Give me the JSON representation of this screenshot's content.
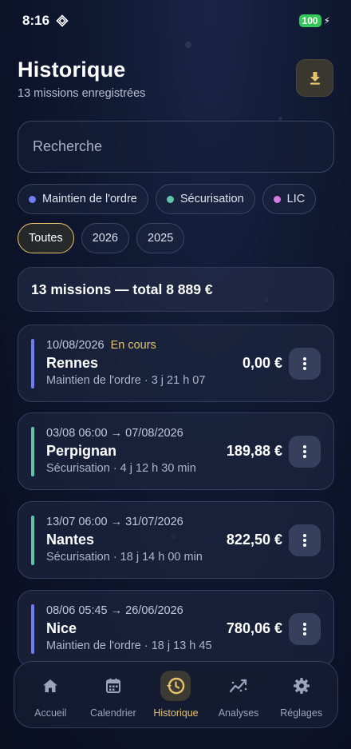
{
  "status_bar": {
    "time": "8:16",
    "battery": "100"
  },
  "header": {
    "title": "Historique",
    "subtitle": "13 missions enregistrées"
  },
  "search": {
    "placeholder": "Recherche"
  },
  "filters": {
    "categories": [
      {
        "label": "Maintien de l'ordre",
        "color": "#6f7df0"
      },
      {
        "label": "Sécurisation",
        "color": "#5fc4a8"
      },
      {
        "label": "LIC",
        "color": "#d47be0"
      }
    ],
    "years": [
      {
        "label": "Toutes",
        "active": true
      },
      {
        "label": "2026",
        "active": false
      },
      {
        "label": "2025",
        "active": false
      }
    ]
  },
  "summary": {
    "text": "13 missions — total 8 889 €"
  },
  "missions": [
    {
      "dates": "10/08/2026",
      "status": "En cours",
      "city": "Rennes",
      "meta": "Maintien de l'ordre · 3 j 21 h 07",
      "amount": "0,00 €",
      "color": "#6f7df0"
    },
    {
      "dates": "03/08 06:00 → 07/08/2026",
      "status": "",
      "city": "Perpignan",
      "meta": "Sécurisation · 4 j 12 h 30 min",
      "amount": "189,88 €",
      "color": "#5fc4a8"
    },
    {
      "dates": "13/07 06:00 → 31/07/2026",
      "status": "",
      "city": "Nantes",
      "meta": "Sécurisation · 18 j 14 h 00 min",
      "amount": "822,50 €",
      "color": "#5fc4a8"
    },
    {
      "dates": "08/06 05:45 → 26/06/2026",
      "status": "",
      "city": "Nice",
      "meta": "Maintien de l'ordre · 18 j 13 h 45",
      "amount": "780,06 €",
      "color": "#6f7df0"
    }
  ],
  "nav": [
    {
      "label": "Accueil",
      "icon": "home-icon",
      "active": false
    },
    {
      "label": "Calendrier",
      "icon": "calendar-icon",
      "active": false
    },
    {
      "label": "Historique",
      "icon": "history-icon",
      "active": true
    },
    {
      "label": "Analyses",
      "icon": "analytics-icon",
      "active": false
    },
    {
      "label": "Réglages",
      "icon": "gear-icon",
      "active": false
    }
  ],
  "colors": {
    "accent": "#e7c46a",
    "background": "#0c1228"
  }
}
